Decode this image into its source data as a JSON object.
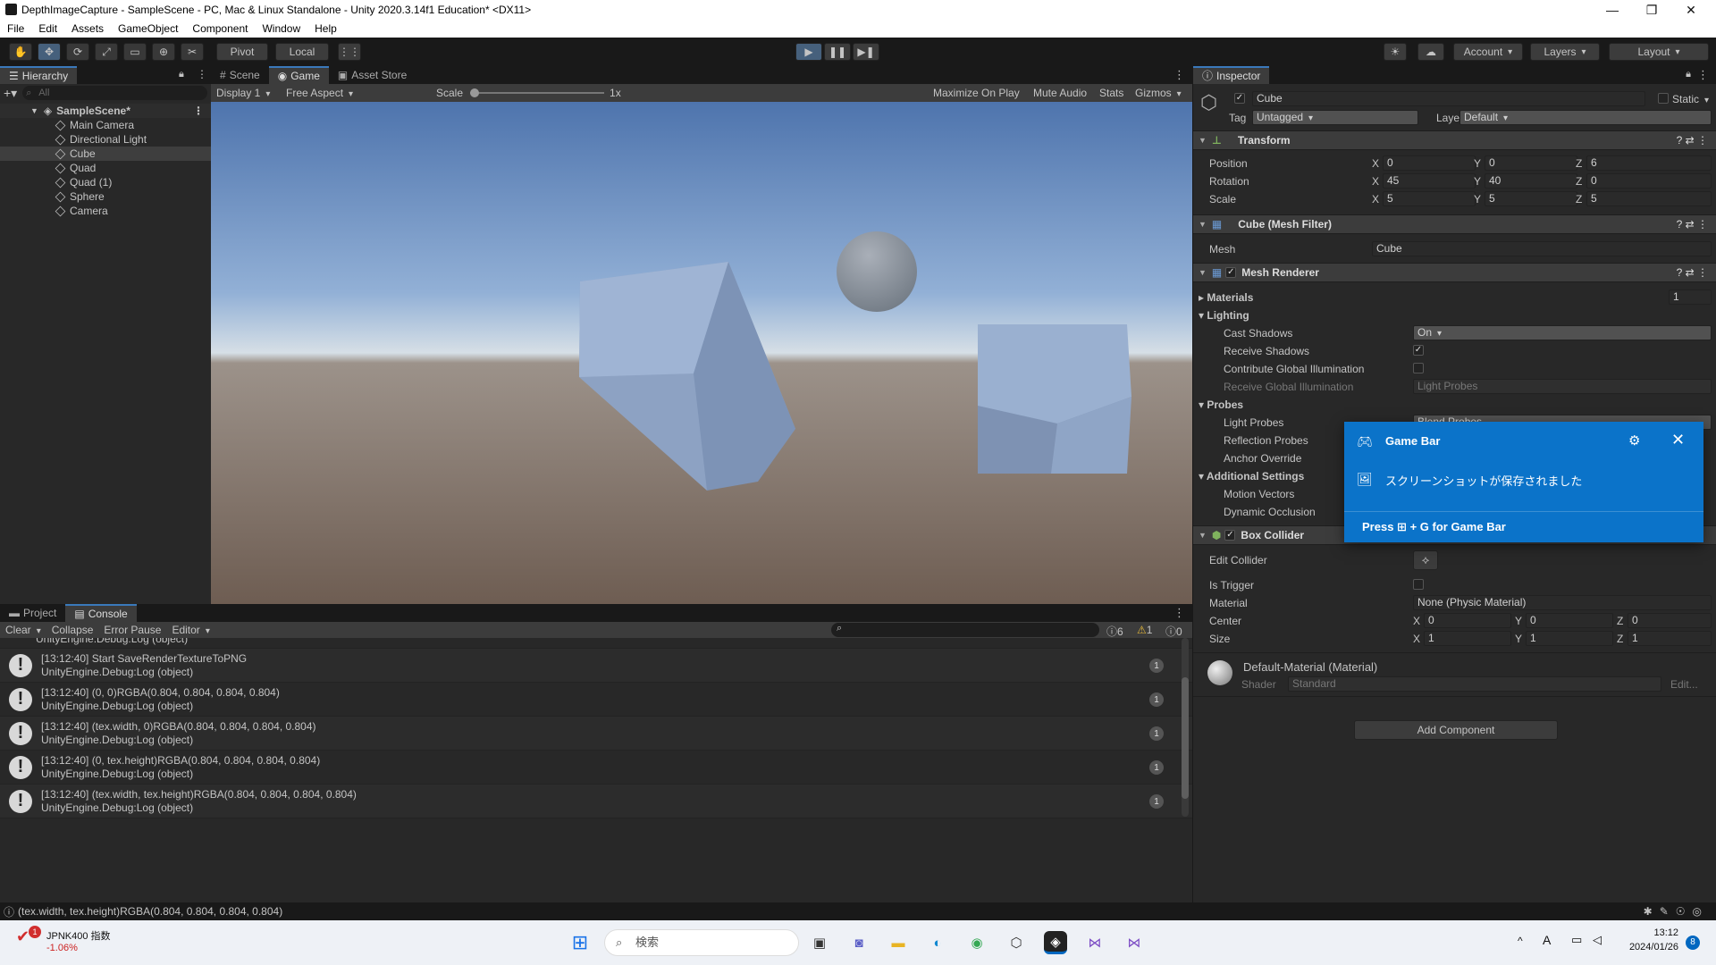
{
  "window": {
    "title": "DepthImageCapture - SampleScene - PC, Mac & Linux Standalone - Unity 2020.3.14f1 Education* <DX11>",
    "controls": [
      "—",
      "❐",
      "✕"
    ]
  },
  "menu": [
    "File",
    "Edit",
    "Assets",
    "GameObject",
    "Component",
    "Window",
    "Help"
  ],
  "toolbar": {
    "pivot": "Pivot",
    "local": "Local",
    "account": "Account",
    "layers": "Layers",
    "layout": "Layout"
  },
  "hierarchy": {
    "tab": "Hierarchy",
    "search_placeholder": "All",
    "scene": "SampleScene*",
    "items": [
      "Main Camera",
      "Directional Light",
      "Cube",
      "Quad",
      "Quad (1)",
      "Sphere",
      "Camera"
    ],
    "selected": "Cube"
  },
  "game_tabs": [
    "Scene",
    "Game",
    "Asset Store"
  ],
  "game_toolbar": {
    "display": "Display 1",
    "aspect": "Free Aspect",
    "scale_label": "Scale",
    "scale_value": "1x",
    "maximize": "Maximize On Play",
    "mute": "Mute Audio",
    "stats": "Stats",
    "gizmos": "Gizmos"
  },
  "console": {
    "tabs": [
      "Project",
      "Console"
    ],
    "toolbar": [
      "Clear",
      "Collapse",
      "Error Pause",
      "Editor"
    ],
    "counts": {
      "log": "6",
      "warn": "1",
      "error": "0"
    },
    "partial_first": "UnityEngine.Debug:Log (object)",
    "entries": [
      {
        "line1": "[13:12:40] Start SaveRenderTextureToPNG",
        "line2": "UnityEngine.Debug:Log (object)",
        "count": "1"
      },
      {
        "line1": "[13:12:40] (0, 0)RGBA(0.804, 0.804, 0.804, 0.804)",
        "line2": "UnityEngine.Debug:Log (object)",
        "count": "1"
      },
      {
        "line1": "[13:12:40] (tex.width, 0)RGBA(0.804, 0.804, 0.804, 0.804)",
        "line2": "UnityEngine.Debug:Log (object)",
        "count": "1"
      },
      {
        "line1": "[13:12:40] (0, tex.height)RGBA(0.804, 0.804, 0.804, 0.804)",
        "line2": "UnityEngine.Debug:Log (object)",
        "count": "1"
      },
      {
        "line1": "[13:12:40] (tex.width, tex.height)RGBA(0.804, 0.804, 0.804, 0.804)",
        "line2": "UnityEngine.Debug:Log (object)",
        "count": "1"
      }
    ]
  },
  "inspector": {
    "tab": "Inspector",
    "object_name": "Cube",
    "static_label": "Static",
    "tag_label": "Tag",
    "tag_value": "Untagged",
    "layer_label": "Layer",
    "layer_value": "Default",
    "transform": {
      "title": "Transform",
      "position_label": "Position",
      "position": [
        "0",
        "0",
        "6"
      ],
      "rotation_label": "Rotation",
      "rotation": [
        "45",
        "40",
        "0"
      ],
      "scale_label": "Scale",
      "scale": [
        "5",
        "5",
        "5"
      ]
    },
    "mesh_filter": {
      "title": "Cube (Mesh Filter)",
      "mesh_label": "Mesh",
      "mesh_value": "Cube"
    },
    "mesh_renderer": {
      "title": "Mesh Renderer",
      "materials": "Materials",
      "materials_count": "1",
      "lighting": "Lighting",
      "cast_shadows": "Cast Shadows",
      "cast_shadows_value": "On",
      "receive_shadows": "Receive Shadows",
      "contribute_gi": "Contribute Global Illumination",
      "receive_gi": "Receive Global Illumination",
      "receive_gi_value": "Light Probes",
      "probes": "Probes",
      "light_probes": "Light Probes",
      "light_probes_value": "Blend Probes",
      "reflection_probes": "Reflection Probes",
      "anchor_override": "Anchor Override",
      "additional": "Additional Settings",
      "motion_vectors": "Motion Vectors",
      "dynamic_occlusion": "Dynamic Occlusion"
    },
    "box_collider": {
      "title": "Box Collider",
      "edit_collider": "Edit Collider",
      "is_trigger": "Is Trigger",
      "material_label": "Material",
      "material_value": "None (Physic Material)",
      "center_label": "Center",
      "center": [
        "0",
        "0",
        "0"
      ],
      "size_label": "Size",
      "size": [
        "1",
        "1",
        "1"
      ]
    },
    "material": {
      "title": "Default-Material (Material)",
      "shader_label": "Shader",
      "shader_value": "Standard",
      "edit": "Edit..."
    },
    "add_component": "Add Component",
    "axes": [
      "X",
      "Y",
      "Z"
    ]
  },
  "gamebar": {
    "title": "Game Bar",
    "message": "スクリーンショットが保存されました",
    "hint_prefix": "Press",
    "hint_suffix": "+ G for Game Bar"
  },
  "statusbar": {
    "message": "(tex.width, tex.height)RGBA(0.804, 0.804, 0.804, 0.804)"
  },
  "taskbar": {
    "stock_name": "JPNK400 指数",
    "stock_change": "-1.06%",
    "stock_badge": "1",
    "search_placeholder": "検索",
    "time": "13:12",
    "date": "2024/01/26",
    "notif_count": "8",
    "ime": "A"
  }
}
